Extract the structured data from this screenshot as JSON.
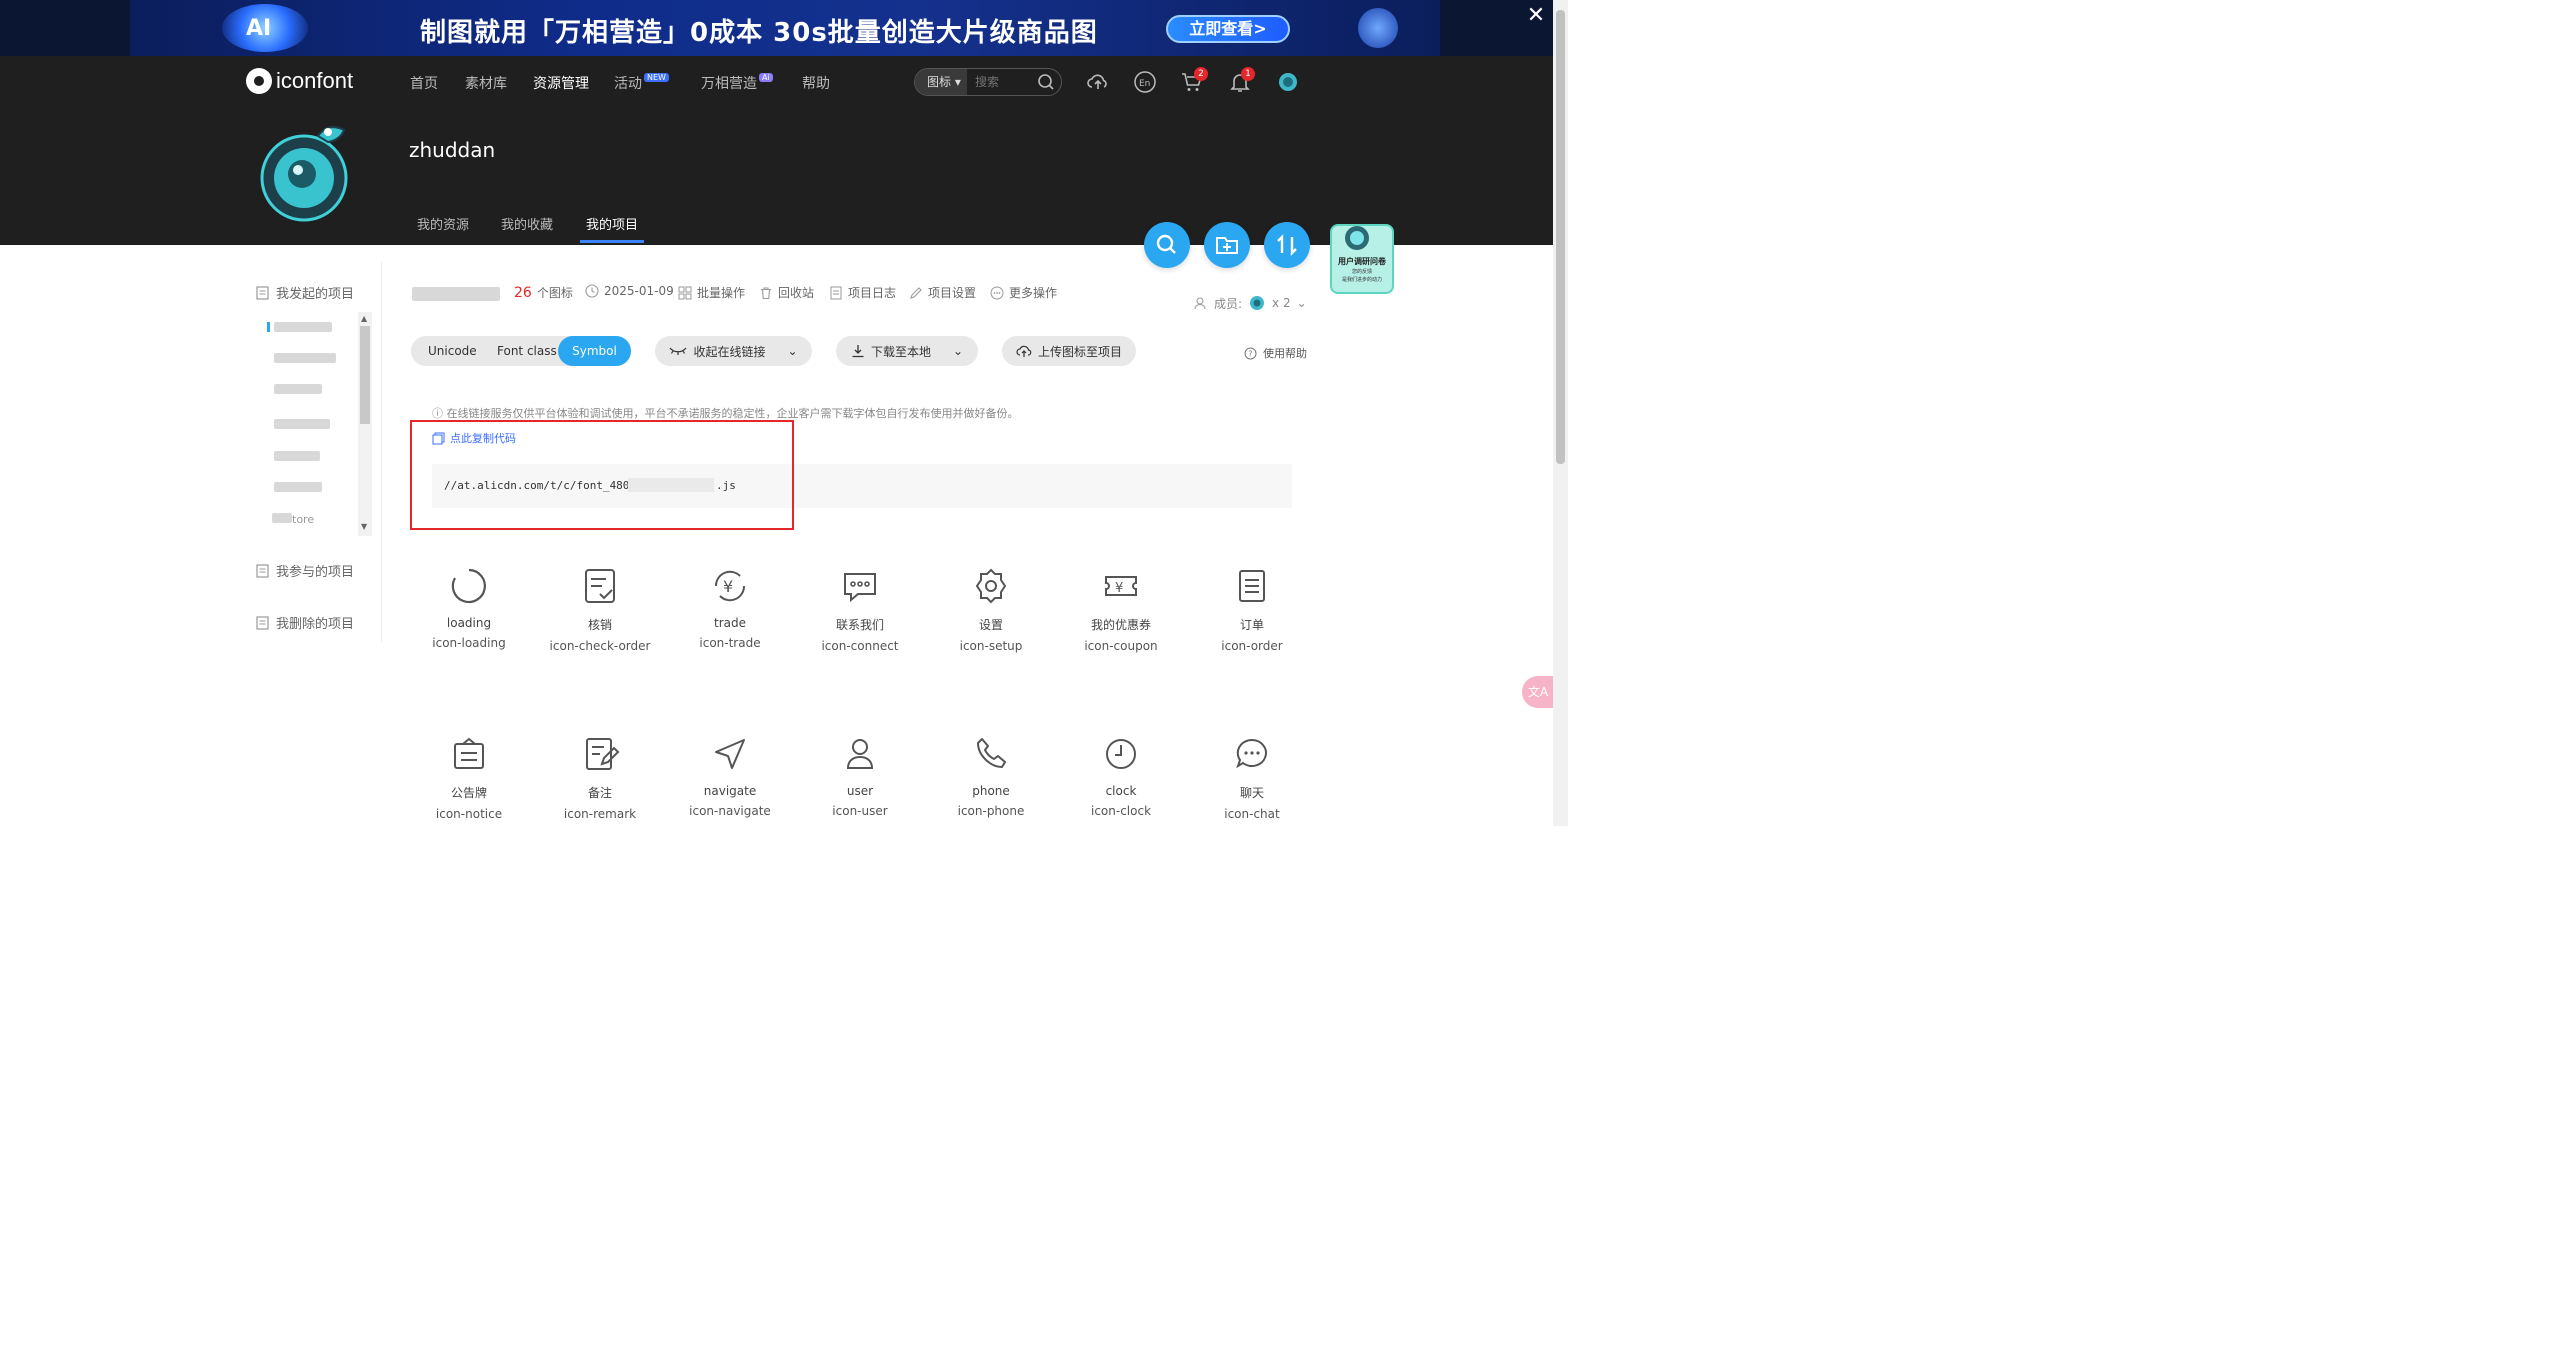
{
  "banner": {
    "ai_label": "AI",
    "title": "制图就用「万相营造」0成本 30s批量创造大片级商品图",
    "cta": "立即查看>"
  },
  "header": {
    "logo": "iconfont",
    "nav": [
      {
        "label": "首页"
      },
      {
        "label": "素材库"
      },
      {
        "label": "资源管理"
      },
      {
        "label": "活动",
        "badge": "NEW"
      },
      {
        "label": "万相营造",
        "badge": "Ai"
      },
      {
        "label": "帮助"
      }
    ],
    "search": {
      "type": "图标",
      "placeholder": "搜索"
    },
    "cart_count": "2",
    "notify_count": "1"
  },
  "profile": {
    "username": "zhuddan",
    "tabs": [
      "我的资源",
      "我的收藏",
      "我的项目"
    ]
  },
  "survey": {
    "title": "用户调研问卷",
    "line1": "您的反馈",
    "line2": "是我们进步的动力"
  },
  "sidebar": {
    "started": "我发起的项目",
    "joined": "我参与的项目",
    "deleted": "我删除的项目",
    "partial_label": "tore"
  },
  "project": {
    "icon_count": "26",
    "icon_count_label": "个图标",
    "date": "2025-01-09",
    "actions": [
      "批量操作",
      "回收站",
      "项目日志",
      "项目设置",
      "更多操作"
    ],
    "members_label": "成员:",
    "members_count": "x 2"
  },
  "toolbar": {
    "tabs": [
      "Unicode",
      "Font class",
      "Symbol"
    ],
    "collapse": "收起在线链接",
    "download": "下载至本地",
    "upload": "上传图标至项目",
    "help": "使用帮助"
  },
  "link": {
    "notice": "在线链接服务仅供平台体验和调试使用，平台不承诺服务的稳定性，企业客户需下载字体包自行发布使用并做好备份。",
    "copy": "点此复制代码",
    "code_prefix": "//at.alicdn.com/t/c/font_48072",
    "code_suffix": ".js"
  },
  "icons": [
    {
      "name": "loading",
      "code": "icon-loading",
      "icon": "loading-icon"
    },
    {
      "name": "核销",
      "code": "icon-check-order",
      "icon": "check-order-icon"
    },
    {
      "name": "trade",
      "code": "icon-trade",
      "icon": "trade-icon"
    },
    {
      "name": "联系我们",
      "code": "icon-connect",
      "icon": "connect-icon"
    },
    {
      "name": "设置",
      "code": "icon-setup",
      "icon": "setup-icon"
    },
    {
      "name": "我的优惠券",
      "code": "icon-coupon",
      "icon": "coupon-icon"
    },
    {
      "name": "订单",
      "code": "icon-order",
      "icon": "order-icon"
    },
    {
      "name": "公告牌",
      "code": "icon-notice",
      "icon": "notice-icon"
    },
    {
      "name": "备注",
      "code": "icon-remark",
      "icon": "remark-icon"
    },
    {
      "name": "navigate",
      "code": "icon-navigate",
      "icon": "navigate-icon"
    },
    {
      "name": "user",
      "code": "icon-user",
      "icon": "user-icon"
    },
    {
      "name": "phone",
      "code": "icon-phone",
      "icon": "phone-icon"
    },
    {
      "name": "clock",
      "code": "icon-clock",
      "icon": "clock-icon"
    },
    {
      "name": "聊天",
      "code": "icon-chat",
      "icon": "chat-icon"
    }
  ],
  "colors": {
    "accent": "#2aa7f0",
    "highlight": "#e5262a",
    "header_bg": "#1f1f1f"
  }
}
